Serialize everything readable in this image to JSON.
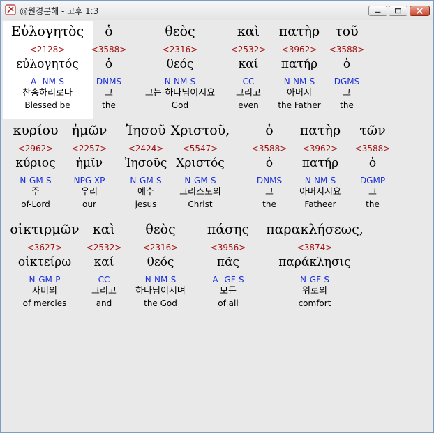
{
  "window": {
    "title": "@원경분해 - 고후 1:3"
  },
  "colors": {
    "strong": "#a01010",
    "parse": "#1a2fd6",
    "highlight": "#ffffff",
    "background": "#e9e9e9"
  },
  "verse": {
    "words": [
      {
        "greek": "Εὐλογητὸς",
        "strong": "<2128>",
        "lemma": "εὐλογητός",
        "parse": "A--NM-S",
        "korean": "찬송하리로다",
        "english": "Blessed be"
      },
      {
        "greek": "ὁ",
        "strong": "<3588>",
        "lemma": "ὁ",
        "parse": "DNMS",
        "korean": "그",
        "english": "the"
      },
      {
        "greek": "θεὸς",
        "strong": "<2316>",
        "lemma": "θεός",
        "parse": "N-NM-S",
        "korean": "그는-하나님이시요",
        "english": "God"
      },
      {
        "greek": "καὶ",
        "strong": "<2532>",
        "lemma": "καί",
        "parse": "CC",
        "korean": "그리고",
        "english": "even"
      },
      {
        "greek": "πατὴρ",
        "strong": "<3962>",
        "lemma": "πατήρ",
        "parse": "N-NM-S",
        "korean": "아버지",
        "english": "the Father"
      },
      {
        "greek": "τοῦ",
        "strong": "<3588>",
        "lemma": "ὁ",
        "parse": "DGMS",
        "korean": "그",
        "english": "the"
      },
      {
        "greek": "κυρίου",
        "strong": "<2962>",
        "lemma": "κύριος",
        "parse": "N-GM-S",
        "korean": "주",
        "english": "of-Lord"
      },
      {
        "greek": "ἡμῶν",
        "strong": "<2257>",
        "lemma": "ἡμῖν",
        "parse": "NPG-XP",
        "korean": "우리",
        "english": "our"
      },
      {
        "greek": "Ἰησοῦ",
        "strong": "<2424>",
        "lemma": "Ἰησοῦς",
        "parse": "N-GM-S",
        "korean": "예수",
        "english": "jesus"
      },
      {
        "greek": "Χριστοῦ,",
        "strong": "<5547>",
        "lemma": "Χριστός",
        "parse": "N-GM-S",
        "korean": "그리스도의",
        "english": "Christ"
      },
      {
        "greek": "ὁ",
        "strong": "<3588>",
        "lemma": "ὁ",
        "parse": "DNMS",
        "korean": "그",
        "english": "the"
      },
      {
        "greek": "πατὴρ",
        "strong": "<3962>",
        "lemma": "πατήρ",
        "parse": "N-NM-S",
        "korean": "아버지시요",
        "english": "Fatheer"
      },
      {
        "greek": "τῶν",
        "strong": "<3588>",
        "lemma": "ὁ",
        "parse": "DGMP",
        "korean": "그",
        "english": "the"
      },
      {
        "greek": "οἰκτιρμῶν",
        "strong": "<3627>",
        "lemma": "οἰκτείρω",
        "parse": "N-GM-P",
        "korean": "자비의",
        "english": "of mercies"
      },
      {
        "greek": "καὶ",
        "strong": "<2532>",
        "lemma": "καί",
        "parse": "CC",
        "korean": "그리고",
        "english": "and"
      },
      {
        "greek": "θεὸς",
        "strong": "<2316>",
        "lemma": "θεός",
        "parse": "N-NM-S",
        "korean": "하나님이시며",
        "english": "the God"
      },
      {
        "greek": "πάσης",
        "strong": "<3956>",
        "lemma": "πᾶς",
        "parse": "A--GF-S",
        "korean": "모든",
        "english": "of all"
      },
      {
        "greek": "παρακλήσεως,",
        "strong": "<3874>",
        "lemma": "παράκλησις",
        "parse": "N-GF-S",
        "korean": "위로의",
        "english": "comfort"
      }
    ]
  }
}
